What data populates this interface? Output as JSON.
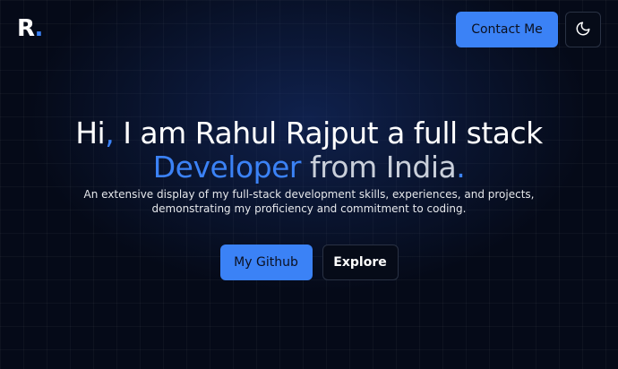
{
  "brand": {
    "letter": "R",
    "dot": "."
  },
  "header": {
    "contact_label": "Contact Me",
    "theme_icon": "moon-icon"
  },
  "hero": {
    "headline": {
      "part1": "Hi",
      "comma": ",",
      "part2": " I am Rahul Rajput a full stack ",
      "highlight": "Developer",
      "part3": " from India",
      "period": "."
    },
    "subtitle": "An extensive display of my full-stack development skills, experiences, and projects, demonstrating my proficiency and commitment to coding."
  },
  "actions": {
    "github_label": "My Github",
    "explore_label": "Explore"
  },
  "colors": {
    "accent": "#3b82f6",
    "background": "#050a18",
    "text": "#ffffff"
  }
}
